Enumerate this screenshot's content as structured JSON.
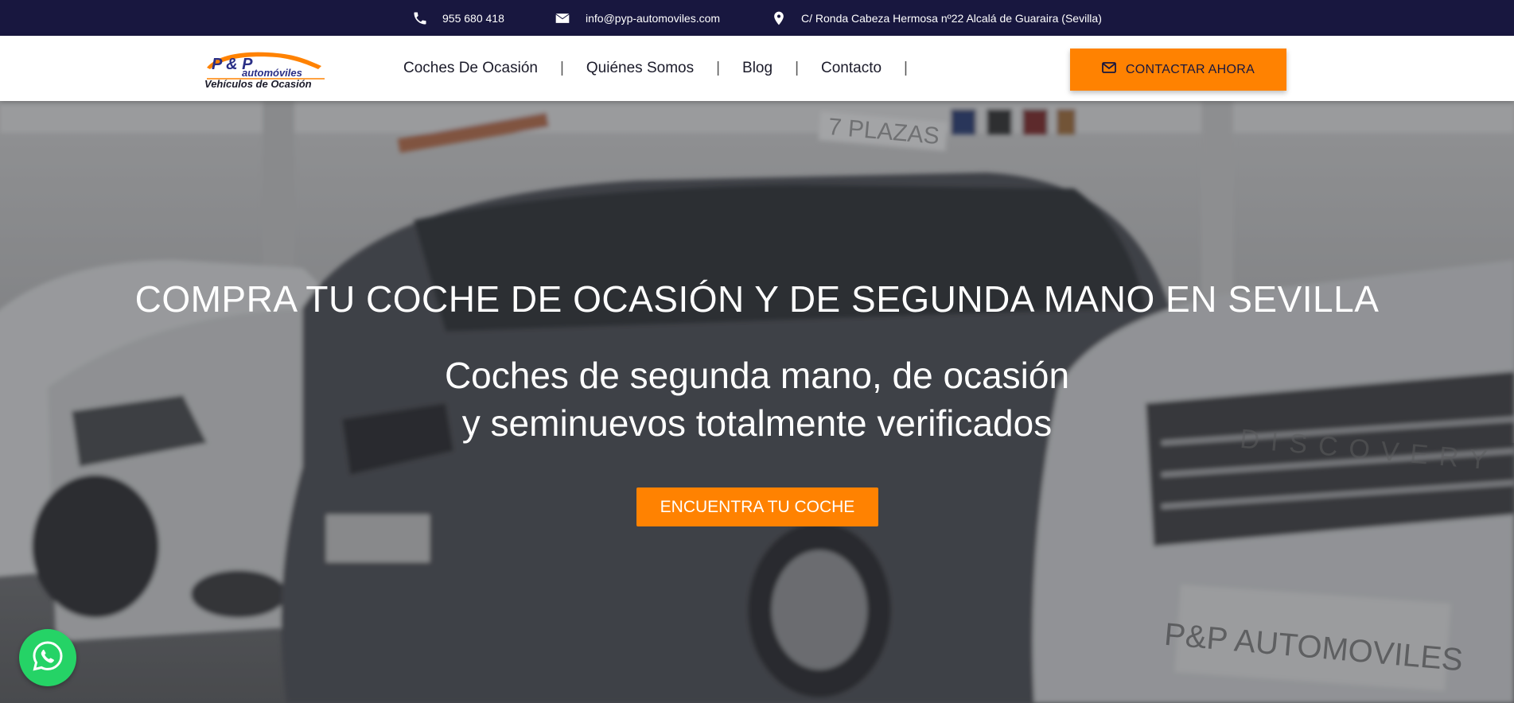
{
  "topbar": {
    "phone": "955 680 418",
    "email": "info@pyp-automoviles.com",
    "address": "C/ Ronda Cabeza Hermosa nº22 Alcalá de Guaraira (Sevilla)",
    "icons": [
      "phone-icon",
      "envelope-icon",
      "map-pin-icon"
    ]
  },
  "logo": {
    "line1": "P & P",
    "line2": "automóviles",
    "line3": "Vehículos de Ocasión"
  },
  "nav": {
    "items": [
      {
        "label": "Coches De Ocasión"
      },
      {
        "label": "Quiénes Somos"
      },
      {
        "label": "Blog"
      },
      {
        "label": "Contacto"
      }
    ],
    "separator": "|"
  },
  "cta": {
    "label": "CONTACTAR AHORA",
    "icon": "envelope-icon"
  },
  "hero": {
    "title": "COMPRA TU COCHE DE OCASIÓN Y DE SEGUNDA MANO EN SEVILLA",
    "subtitle_line1": "Coches de segunda mano, de ocasión",
    "subtitle_line2": "y seminuevos totalmente verificados",
    "button": "ENCUENTRA TU COCHE",
    "background_text_plate1": "P&P AUTOMOVILES",
    "background_text_sign": "7 PLAZAS",
    "background_text_brand": "DISCOVERY"
  },
  "whatsapp": {
    "icon": "whatsapp-icon"
  },
  "colors": {
    "topbar": "#18173f",
    "accent": "#ff8201",
    "whatsapp": "#25d366",
    "logo_blue": "#2a2f86"
  }
}
